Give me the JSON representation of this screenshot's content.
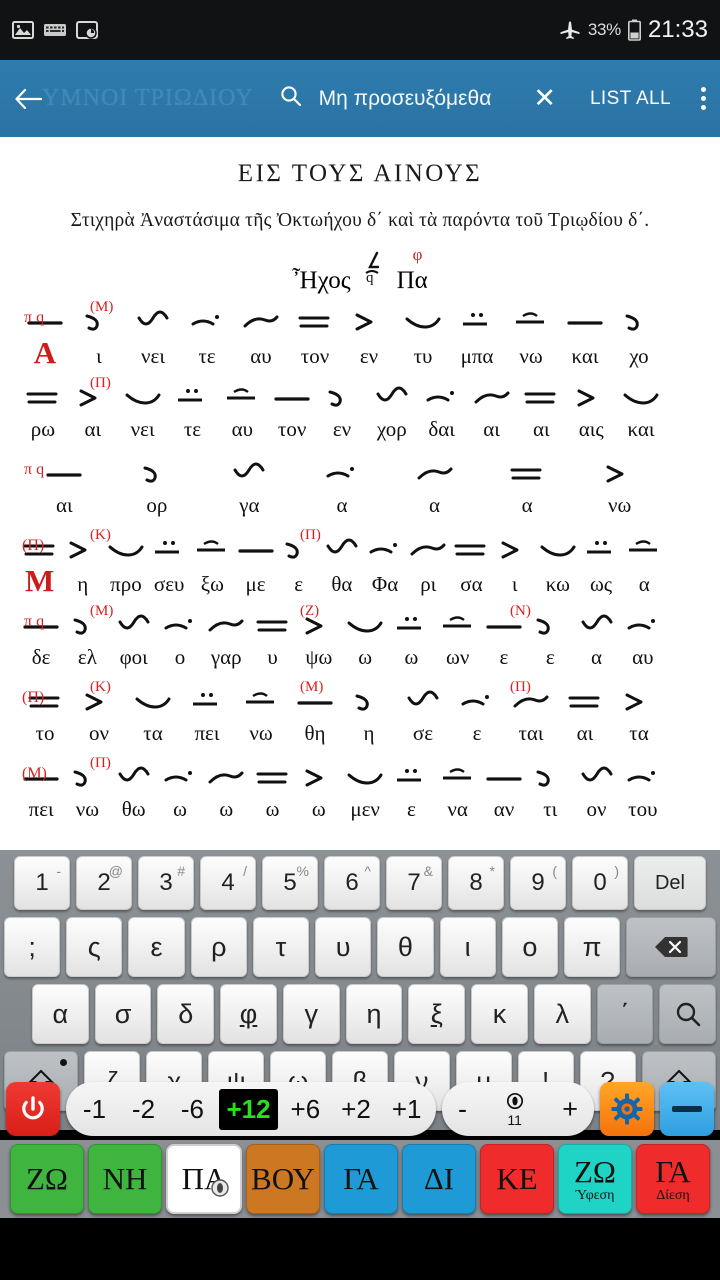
{
  "statusbar": {
    "icons": [
      "image-icon",
      "keyboard-icon",
      "screen-record-icon",
      "airplane-mode-icon"
    ],
    "battery_percent": "33%",
    "clock": "21:33"
  },
  "appbar": {
    "back_label": "back-arrow",
    "title": "ΥΜΝΟΙ ΤΡΙΩΔΙΟΥ",
    "search_value": "Μη προσευξόμεθα",
    "clear_label": "✕",
    "list_all_label": "LIST ALL",
    "overflow_label": "overflow-menu",
    "bg_color": "#2d78a8"
  },
  "document": {
    "title": "ΕΙΣ ΤΟΥΣ ΑΙΝΟΥΣ",
    "subtitle": "Στιχηρὰ Ἀναστάσιμα τῆς Ὀκτωήχου δ΄ καὶ τὰ παρόντα τοῦ Τριῳδίου δ΄.",
    "echos_label": "Ἦχος",
    "echos_mode_mark": "δ",
    "echos_note": "Πα",
    "echos_martyria": "φ",
    "red_color": "#d82020",
    "lines": [
      {
        "drop_cap": "Α",
        "left_martyria": "π q",
        "top_marks": [
          "(Μ)"
        ],
        "syllables": [
          "ι",
          "νει",
          "τε",
          "αυ",
          "τον",
          "εν",
          "τυ",
          "μπα",
          "νω",
          "και",
          "χο"
        ]
      },
      {
        "drop_cap": "",
        "left_martyria": "",
        "top_marks": [
          "(Π)"
        ],
        "syllables": [
          "ρω",
          "αι",
          "νει",
          "τε",
          "αυ",
          "τον",
          "εν",
          "χορ",
          "δαι",
          "αι",
          "αι",
          "αις",
          "και"
        ]
      },
      {
        "drop_cap": "",
        "left_martyria": "π q",
        "top_marks": [],
        "syllables": [
          "αι",
          "ορ",
          "γα",
          "α",
          "α",
          "α",
          "νω"
        ]
      },
      {
        "drop_cap": "Μ",
        "left_martyria": "(Π)",
        "top_marks": [
          "(Κ)",
          "(Π)"
        ],
        "syllables": [
          "η",
          "προ",
          "σευ",
          "ξω",
          "με",
          "ε",
          "θα",
          "Φα",
          "ρι",
          "σα",
          "ι",
          "κω",
          "ως",
          "α"
        ]
      },
      {
        "drop_cap": "",
        "left_martyria": "π q",
        "top_marks": [
          "(Μ)",
          "(Ζ)",
          "(Ν)"
        ],
        "syllables": [
          "δε",
          "ελ",
          "φοι",
          "ο",
          "γαρ",
          "υ",
          "ψω",
          "ω",
          "ω",
          "ων",
          "ε",
          "ε",
          "α",
          "αυ"
        ]
      },
      {
        "drop_cap": "",
        "left_martyria": "(Π)",
        "top_marks": [
          "(Κ)",
          "(Μ)",
          "(Π)"
        ],
        "syllables": [
          "το",
          "ον",
          "τα",
          "πει",
          "νω",
          "θη",
          "η",
          "σε",
          "ε",
          "ται",
          "αι",
          "τα"
        ]
      },
      {
        "drop_cap": "",
        "left_martyria": "(Μ)",
        "top_marks": [
          "(Π)"
        ],
        "syllables": [
          "πει",
          "νω",
          "θω",
          "ω",
          "ω",
          "ω",
          "ω",
          "μεν",
          "ε",
          "να",
          "αν",
          "τι",
          "ον",
          "του"
        ]
      }
    ]
  },
  "keyboard": {
    "row1": [
      {
        "main": "1",
        "sup": "-"
      },
      {
        "main": "2",
        "sup": "@"
      },
      {
        "main": "3",
        "sup": "#"
      },
      {
        "main": "4",
        "sup": "/"
      },
      {
        "main": "5",
        "sup": "%"
      },
      {
        "main": "6",
        "sup": "^"
      },
      {
        "main": "7",
        "sup": "&"
      },
      {
        "main": "8",
        "sup": "*"
      },
      {
        "main": "9",
        "sup": "("
      },
      {
        "main": "0",
        "sup": ")"
      },
      {
        "main": "Del",
        "sup": ""
      }
    ],
    "row2": [
      ";",
      "ς",
      "ε",
      "ρ",
      "τ",
      "υ",
      "θ",
      "ι",
      "ο",
      "π",
      "backspace-icon"
    ],
    "row3": [
      "α",
      "σ",
      "δ",
      "φ",
      "γ",
      "η",
      "ξ",
      "κ",
      "λ",
      "΄",
      "search-icon"
    ],
    "row4": [
      "shift-icon",
      "ζ",
      "χ",
      "ψ",
      "ω",
      "β",
      "ν",
      "μ",
      "!",
      "?",
      "shift-icon"
    ]
  },
  "transpose_bar": {
    "power_label": "power-icon",
    "steps": [
      "-1",
      "-2",
      "-6",
      "+12",
      "+6",
      "+2",
      "+1"
    ],
    "active_step": "+12",
    "active_color": "#27e020",
    "tempo_minus": "-",
    "tempo_value": "11",
    "tempo_plus": "+",
    "gear_label": "settings-gear-icon",
    "minimize_label": "minimize-icon"
  },
  "note_buttons": [
    {
      "label": "ΖΩ",
      "sub": "",
      "color": "#3fb53f",
      "selected": false
    },
    {
      "label": "ΝΗ",
      "sub": "",
      "color": "#3fb53f",
      "selected": false
    },
    {
      "label": "ΠΑ",
      "sub": "",
      "color": "#ffffff",
      "selected": true
    },
    {
      "label": "ΒΟΥ",
      "sub": "",
      "color": "#cc7722",
      "selected": false
    },
    {
      "label": "ΓΑ",
      "sub": "",
      "color": "#1e9ad6",
      "selected": false
    },
    {
      "label": "ΔΙ",
      "sub": "",
      "color": "#1e9ad6",
      "selected": false
    },
    {
      "label": "ΚΕ",
      "sub": "",
      "color": "#ef2b2b",
      "selected": false
    },
    {
      "label": "ΖΩ",
      "sub": "Ύφεση",
      "color": "#1fd4c4",
      "selected": false
    },
    {
      "label": "ΓΑ",
      "sub": "Δίεση",
      "color": "#ef2b2b",
      "selected": false
    }
  ]
}
